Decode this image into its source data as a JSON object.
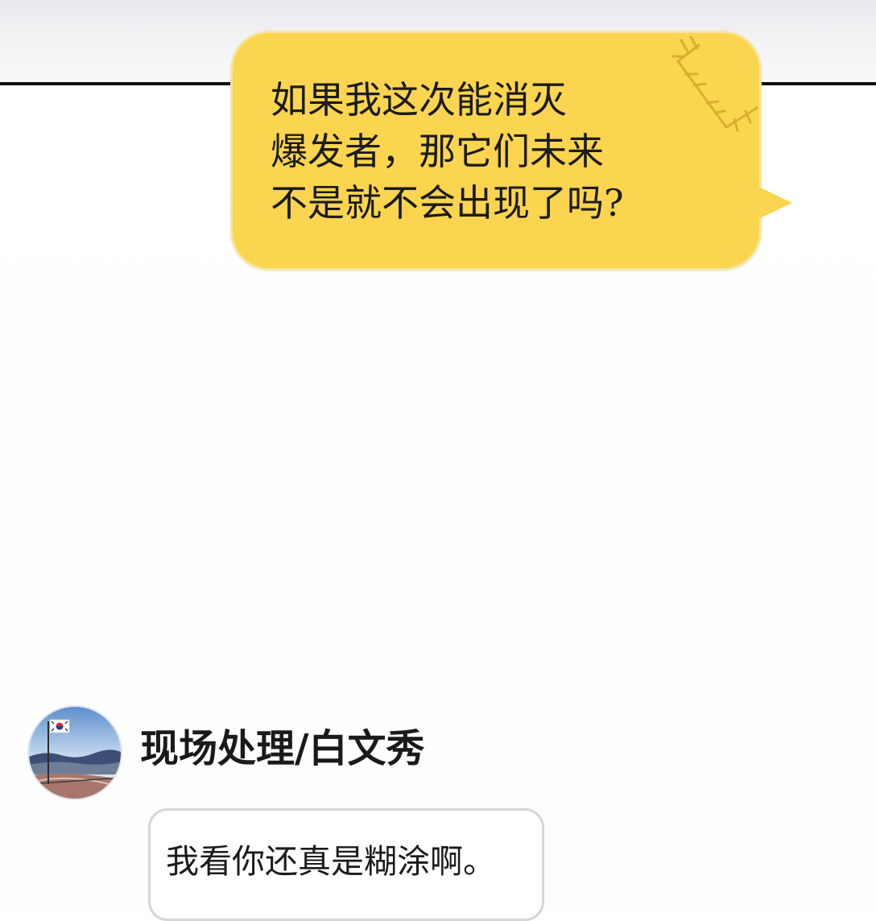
{
  "messages": {
    "sent": {
      "text": "如果我这次能消灭\n爆发者，那它们未来\n不是就不会出现了吗?",
      "bubble_color": "#fbd54f"
    },
    "received": {
      "sender_name": "现场处理/白文秀",
      "text": "我看你还真是糊涂啊。",
      "bubble_color": "#ffffff"
    }
  },
  "icons": {
    "stitch": "stitch-decoration-icon",
    "avatar": "profile-avatar-mountain-flag"
  }
}
